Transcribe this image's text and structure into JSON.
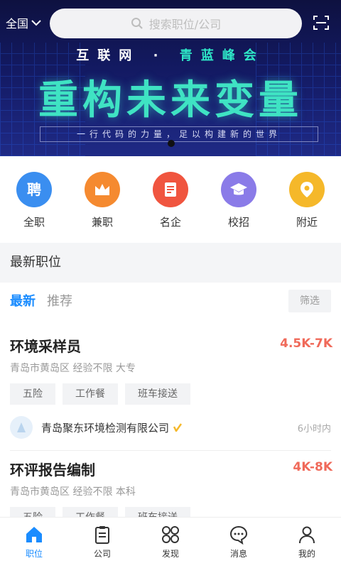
{
  "header": {
    "region": "全国",
    "search_placeholder": "搜索职位/公司"
  },
  "banner": {
    "top_left": "互联网",
    "top_sep": "·",
    "top_right": "青蓝峰会",
    "headline": "重构未来变量",
    "tagline": "一行代码的力量，足以构建新的世界"
  },
  "categories": [
    {
      "label": "全职",
      "icon": "hire-icon",
      "color": "#3a8ef0"
    },
    {
      "label": "兼职",
      "icon": "crown-icon",
      "color": "#f58a30"
    },
    {
      "label": "名企",
      "icon": "document-icon",
      "color": "#f0553f"
    },
    {
      "label": "校招",
      "icon": "graduation-cap-icon",
      "color": "#8a7be8"
    },
    {
      "label": "附近",
      "icon": "location-pin-icon",
      "color": "#f5b82a"
    }
  ],
  "section_title": "最新职位",
  "tabs": {
    "active": "最新",
    "other": "推荐"
  },
  "filter_label": "筛选",
  "jobs": [
    {
      "title": "环境采样员",
      "salary": "4.5K-7K",
      "meta": "青岛市黄岛区 经验不限 大专",
      "tags": [
        "五险",
        "工作餐",
        "班车接送"
      ],
      "company": "青岛聚东环境检测有限公司",
      "time": "6小时内"
    },
    {
      "title": "环评报告编制",
      "salary": "4K-8K",
      "meta": "青岛市黄岛区 经验不限 本科",
      "tags": [
        "五险",
        "工作餐",
        "班车接送"
      ]
    }
  ],
  "nav": [
    {
      "label": "职位",
      "icon": "home-icon"
    },
    {
      "label": "公司",
      "icon": "clipboard-icon"
    },
    {
      "label": "发现",
      "icon": "grid-icon"
    },
    {
      "label": "消息",
      "icon": "chat-icon"
    },
    {
      "label": "我的",
      "icon": "user-icon"
    }
  ],
  "colors": {
    "accent": "#1a8cff",
    "salary": "#f06a5a",
    "headline": "#3fe3c3"
  }
}
